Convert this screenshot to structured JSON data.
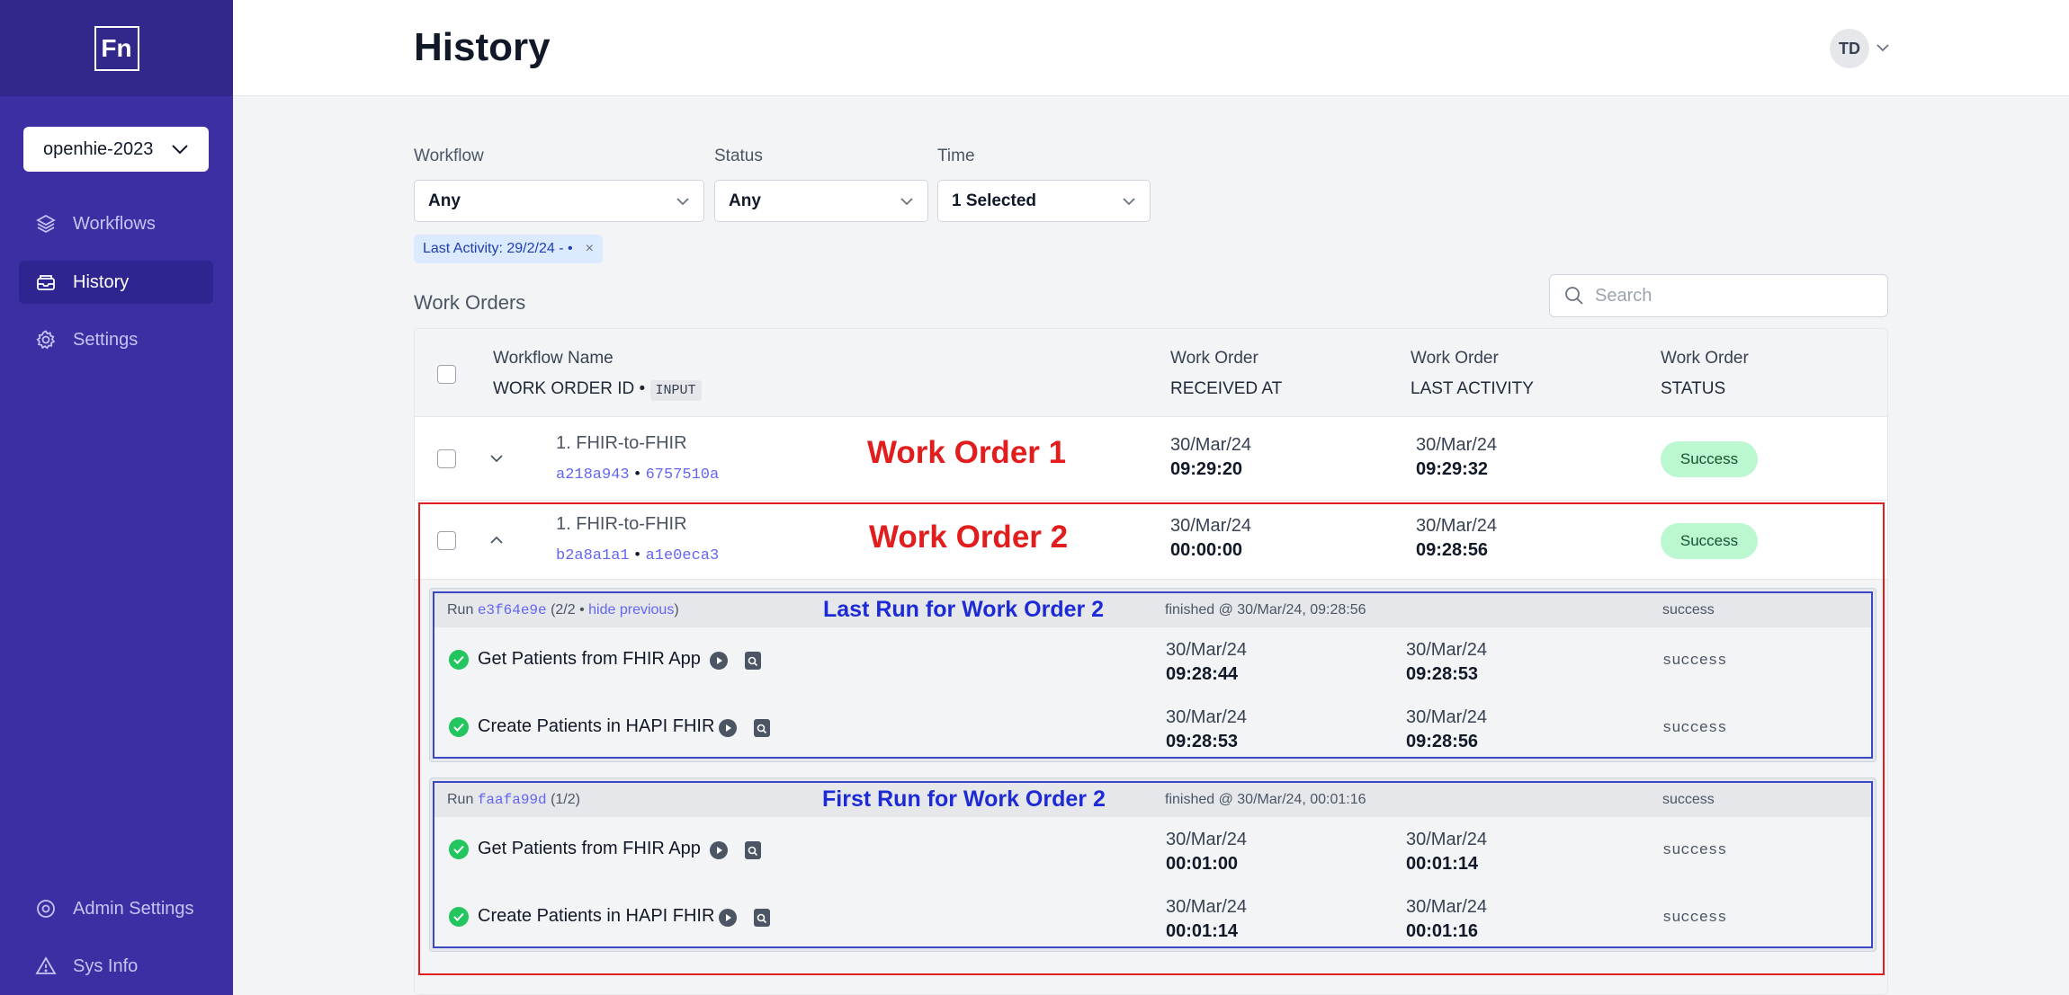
{
  "app": {
    "logo_text": "Fn",
    "project": "openhie-2023"
  },
  "sidebar": {
    "items": [
      {
        "label": "Workflows",
        "icon": "layers-icon"
      },
      {
        "label": "History",
        "icon": "inbox-icon",
        "active": true
      },
      {
        "label": "Settings",
        "icon": "gear-icon"
      }
    ],
    "bottom": [
      {
        "label": "Admin Settings",
        "icon": "gear-icon"
      },
      {
        "label": "Sys Info",
        "icon": "warning-icon"
      }
    ]
  },
  "header": {
    "title": "History",
    "avatar": "TD"
  },
  "filters": {
    "workflow": {
      "label": "Workflow",
      "value": "Any"
    },
    "status": {
      "label": "Status",
      "value": "Any"
    },
    "time": {
      "label": "Time",
      "value": "1 Selected"
    },
    "chip": "Last Activity: 29/2/24 - •"
  },
  "work_orders": {
    "title": "Work Orders",
    "search_placeholder": "Search",
    "columns": {
      "name": "Workflow Name",
      "id": "WORK ORDER ID •",
      "input_tag": "INPUT",
      "received_top": "Work Order",
      "received_bottom": "RECEIVED AT",
      "activity_top": "Work Order",
      "activity_bottom": "LAST ACTIVITY",
      "status_top": "Work Order",
      "status_bottom": "STATUS"
    },
    "rows": [
      {
        "name": "1. FHIR-to-FHIR",
        "id": "a218a943",
        "input": "6757510a",
        "annotation": "Work Order 1",
        "received_date": "30/Mar/24",
        "received_time": "09:29:20",
        "activity_date": "30/Mar/24",
        "activity_time": "09:29:32",
        "status": "Success"
      },
      {
        "name": "1. FHIR-to-FHIR",
        "id": "b2a8a1a1",
        "input": "a1e0eca3",
        "annotation": "Work Order 2",
        "received_date": "30/Mar/24",
        "received_time": "00:00:00",
        "activity_date": "30/Mar/24",
        "activity_time": "09:28:56",
        "status": "Success"
      }
    ],
    "runs": [
      {
        "prefix": "Run",
        "id": "e3f64e9e",
        "count": "(2/2 •",
        "link": "hide previous",
        "close": ")",
        "annotation": "Last Run for Work Order 2",
        "finished": "finished @ 30/Mar/24, 09:28:56",
        "status": "success",
        "steps": [
          {
            "name": "Get Patients from FHIR App",
            "start_date": "30/Mar/24",
            "start_time": "09:28:44",
            "end_date": "30/Mar/24",
            "end_time": "09:28:53",
            "status": "success"
          },
          {
            "name": "Create Patients in HAPI FHIR",
            "start_date": "30/Mar/24",
            "start_time": "09:28:53",
            "end_date": "30/Mar/24",
            "end_time": "09:28:56",
            "status": "success"
          }
        ]
      },
      {
        "prefix": "Run",
        "id": "faafa99d",
        "count": "(1/2)",
        "link": "",
        "close": "",
        "annotation": "First Run for Work Order 2",
        "finished": "finished @ 30/Mar/24, 00:01:16",
        "status": "success",
        "steps": [
          {
            "name": "Get Patients from FHIR App",
            "start_date": "30/Mar/24",
            "start_time": "00:01:00",
            "end_date": "30/Mar/24",
            "end_time": "00:01:14",
            "status": "success"
          },
          {
            "name": "Create Patients in HAPI FHIR",
            "start_date": "30/Mar/24",
            "start_time": "00:01:14",
            "end_date": "30/Mar/24",
            "end_time": "00:01:16",
            "status": "success"
          }
        ]
      }
    ]
  },
  "colors": {
    "sidebar": "#3b2fa3",
    "accent": "#6366f1",
    "success_badge": "#bbf7d0",
    "annotation_red": "#e11d1d",
    "annotation_blue": "#1d2bd6"
  }
}
